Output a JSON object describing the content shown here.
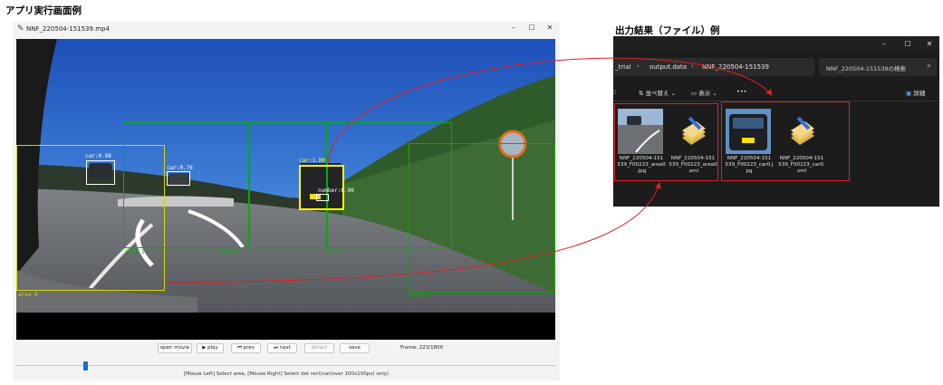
{
  "captions": {
    "left": "アプリ実行画面例",
    "right": "出力結果（ファイル）例"
  },
  "app": {
    "icon": "pen-icon",
    "title": "NNF_220504-151539.mp4",
    "window_controls": [
      "–",
      "☐",
      "✕"
    ],
    "detections": [
      {
        "label": "car:0.98",
        "color": "#ffffff"
      },
      {
        "label": "car:0.76",
        "color": "#ffffff"
      },
      {
        "label": "car:1.00",
        "color": "#ffff00"
      },
      {
        "label": "number:0.90",
        "color": "#ffffff"
      }
    ],
    "areas": [
      {
        "label": "area 0",
        "color": "#d8d800"
      },
      {
        "label": "area 1",
        "color": "#00b000"
      },
      {
        "label": "area 2",
        "color": "#00b000"
      },
      {
        "label": "area 3",
        "color": "#00b000"
      },
      {
        "label": "area 4",
        "color": "#00b000"
      }
    ],
    "controls": {
      "open_movie": "open movie",
      "play": "▶ play",
      "prev": "⏮ prev",
      "next": "⏭ next",
      "detect": "detect",
      "save": "save",
      "frame": "Frame: 223/1800"
    },
    "slider": {
      "current": 223,
      "total": 1800
    },
    "help": "[Mouse Left] Select area, [Mouse Right] Select det rect(car(over 100x100px) only)"
  },
  "explorer": {
    "window_controls": [
      "–",
      "☐",
      "✕"
    ],
    "breadcrumbs": [
      "_trial",
      "output.data",
      "NNF_220504-151539"
    ],
    "search_placeholder": "NNF_220504-151539の検索",
    "toolbar": {
      "sort": "並べ替え",
      "view": "表示",
      "more": "•••",
      "details": "詳細"
    },
    "files": [
      {
        "name": "NNF_220504-151539_F00223_area0.jpg",
        "type": "image-road"
      },
      {
        "name": "NNF_220504-151539_F00223_area0.xml",
        "type": "xml"
      },
      {
        "name": "NNF_220504-151539_F00223_car0.jpg",
        "type": "image-car"
      },
      {
        "name": "NNF_220504-151539_F00223_car0.xml",
        "type": "xml"
      }
    ],
    "file_display_names": [
      "NNF_220504-151\n539_F00223_area0\n.jpg",
      "NNF_220504-151\n539_F00223_area0\n.xml",
      "NNF_220504-151\n539_F00223_car0.j\npg",
      "NNF_220504-151\n539_F00223_car0.\nxml"
    ]
  },
  "colors": {
    "annotation_arrow": "#e02020",
    "slider_thumb": "#0a6fd6"
  }
}
